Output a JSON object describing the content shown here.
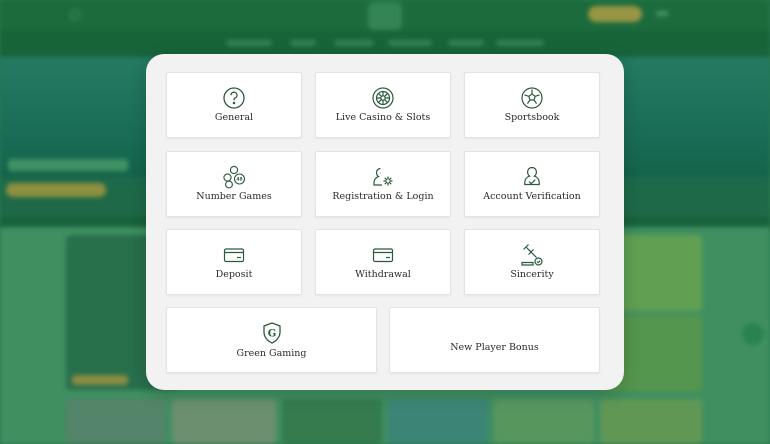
{
  "modal": {
    "categories": [
      {
        "label": "General",
        "icon": "question-circle-icon"
      },
      {
        "label": "Live Casino & Slots",
        "icon": "roulette-wheel-icon"
      },
      {
        "label": "Sportsbook",
        "icon": "soccer-ball-icon"
      },
      {
        "label": "Number Games",
        "icon": "lottery-balls-icon"
      },
      {
        "label": "Registration & Login",
        "icon": "user-settings-icon"
      },
      {
        "label": "Account Verification",
        "icon": "user-verify-icon"
      },
      {
        "label": "Deposit",
        "icon": "card-deposit-icon"
      },
      {
        "label": "Withdrawal",
        "icon": "card-withdrawal-icon"
      },
      {
        "label": "Sincerity",
        "icon": "gavel-check-icon"
      },
      {
        "label": "Green Gaming",
        "icon": "shield-g-icon"
      },
      {
        "label": "New Player Bonus",
        "icon": ""
      }
    ]
  },
  "colors": {
    "icon_stroke": "#2a5a3e",
    "modal_bg": "#f2f2f2",
    "card_bg": "#ffffff",
    "site_green": "#1e6a3e"
  }
}
